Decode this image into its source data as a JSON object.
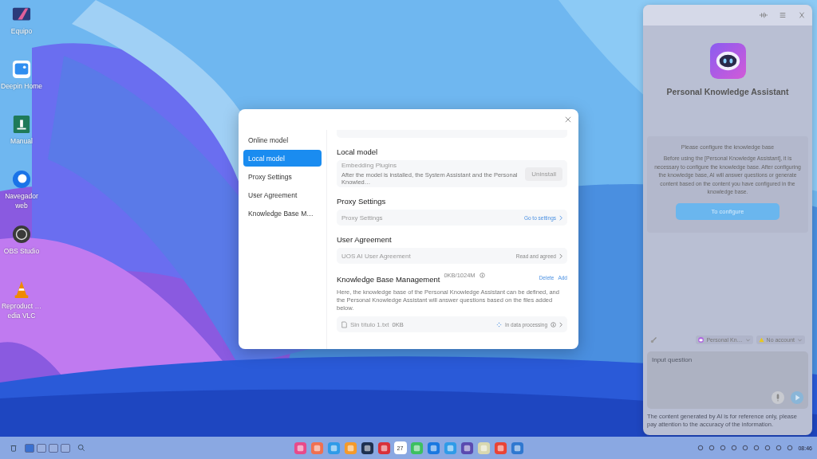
{
  "desktop_icons": [
    {
      "label": "Equipo",
      "kind": "computer"
    },
    {
      "label": "Deepin Home",
      "kind": "home"
    },
    {
      "label": "Manual",
      "kind": "manual"
    },
    {
      "label": "Navegador web",
      "kind": "browser"
    },
    {
      "label": "OBS Studio",
      "kind": "obs"
    },
    {
      "label": "Reproduct …edia VLC",
      "kind": "vlc"
    }
  ],
  "settings_dialog": {
    "nav": [
      {
        "label": "Online model",
        "selected": false
      },
      {
        "label": "Local model",
        "selected": true
      },
      {
        "label": "Proxy Settings",
        "selected": false
      },
      {
        "label": "User Agreement",
        "selected": false
      },
      {
        "label": "Knowledge Base M…",
        "selected": false
      }
    ],
    "local_model": {
      "heading": "Local model",
      "plugin_title": "Embedding Plugins",
      "plugin_description": "After the model is installed, the System Assistant and the Personal Knowled…",
      "button": "Uninstall"
    },
    "proxy": {
      "heading": "Proxy Settings",
      "label": "Proxy Settings",
      "action": "Go to settings"
    },
    "agreement": {
      "heading": "User Agreement",
      "label": "UOS AI User Agreement",
      "action": "Read and agreed"
    },
    "knowledge_base": {
      "heading": "Knowledge Base Management",
      "usage": "0KB/1024M",
      "actions": [
        "Delete",
        "Add"
      ],
      "description": "Here, the knowledge base of the Personal Knowledge Assistant can be defined, and the Personal Knowledge Assistant will answer questions based on the files added below.",
      "file": {
        "name": "Sin título 1.txt",
        "size": "0KB",
        "status": "In data processing"
      }
    }
  },
  "assistant_panel": {
    "title": "Personal Knowledge Assistant",
    "notice_heading": "Please configure the knowledge base",
    "notice_body": "Before using the [Personal Knowledge Assistant], it is necessary to configure the knowledge base. After configuring the knowledge base, AI will answer questions or generate content based on the content you have configured in the knowledge base.",
    "button": "To configure",
    "assistant_select": "Personal Kn…",
    "account_select": "No account",
    "input": {
      "placeholder": "Input question"
    },
    "disclaimer": "The content generated by AI is for reference only, please pay attention to the accuracy of the information."
  },
  "taskbar": {
    "calendar_day": "27",
    "time": "08:46"
  }
}
